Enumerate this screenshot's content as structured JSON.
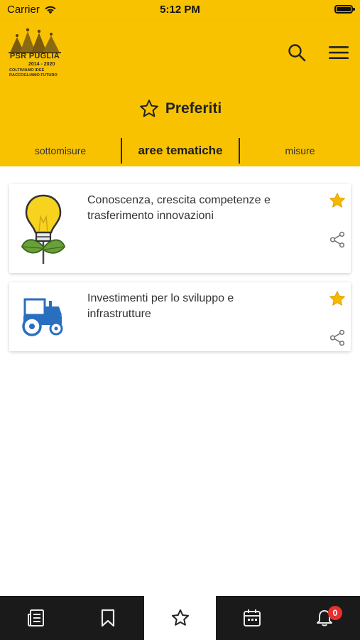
{
  "status_bar": {
    "carrier": "Carrier",
    "time": "5:12 PM"
  },
  "header": {
    "logo": {
      "title": "PSR PUGLIA",
      "years": "2014 - 2020",
      "tagline_1": "COLTIVIAMO IDEE",
      "tagline_2": "RACCOGLIAMO FUTURO"
    },
    "search_icon": "search-icon",
    "menu_icon": "hamburger-menu-icon"
  },
  "page": {
    "title": "Preferiti",
    "title_icon": "star-outline-icon"
  },
  "tabs": [
    {
      "label": "sottomisure",
      "active": false
    },
    {
      "label": "aree tematiche",
      "active": true
    },
    {
      "label": "misure",
      "active": false
    }
  ],
  "cards": [
    {
      "text": "Conoscenza, crescita competenze e trasferimento innovazioni",
      "icon": "lightbulb-plant-icon",
      "favorite": true
    },
    {
      "text": "Investimenti per lo sviluppo e infrastrutture",
      "icon": "tractor-icon",
      "favorite": true
    }
  ],
  "bottom_nav": [
    {
      "icon": "news-list-icon",
      "active": false
    },
    {
      "icon": "bookmark-icon",
      "active": false
    },
    {
      "icon": "star-outline-icon",
      "active": true
    },
    {
      "icon": "calendar-icon",
      "active": false
    },
    {
      "icon": "bell-icon",
      "active": false,
      "badge": "0"
    }
  ],
  "colors": {
    "brand_yellow": "#f8c200",
    "star_fill": "#f5b800",
    "badge_red": "#e8312f",
    "nav_dark": "#1a1a1a"
  }
}
